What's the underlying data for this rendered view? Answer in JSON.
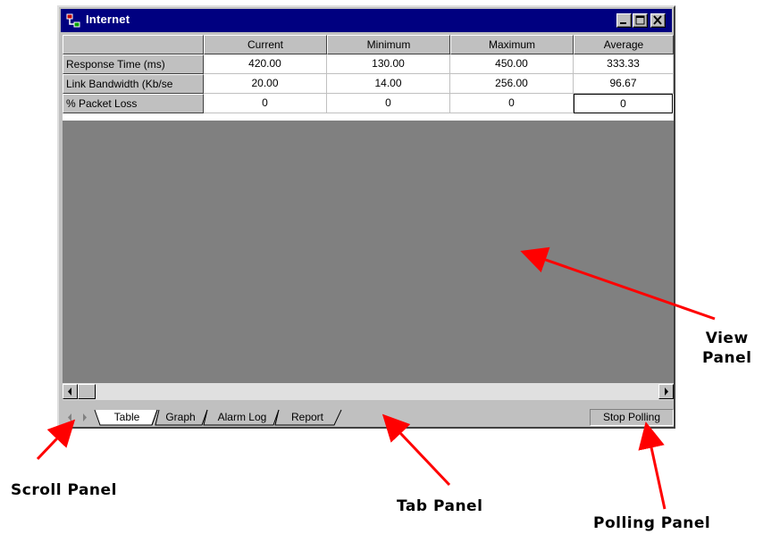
{
  "window": {
    "title": "Internet",
    "controls": [
      "minimize",
      "maximize",
      "close"
    ]
  },
  "table": {
    "columns": [
      "Current",
      "Minimum",
      "Maximum",
      "Average"
    ],
    "rows": [
      {
        "label": "Response Time (ms)",
        "values": [
          "420.00",
          "130.00",
          "450.00",
          "333.33"
        ]
      },
      {
        "label": "Link Bandwidth (Kb/se",
        "values": [
          "20.00",
          "14.00",
          "256.00",
          "96.67"
        ]
      },
      {
        "label": "% Packet Loss",
        "values": [
          "0",
          "0",
          "0",
          "0"
        ]
      }
    ]
  },
  "tabs": [
    {
      "label": "Table",
      "active": true
    },
    {
      "label": "Graph",
      "active": false
    },
    {
      "label": "Alarm Log",
      "active": false
    },
    {
      "label": "Report",
      "active": false
    }
  ],
  "polling": {
    "label": "Stop Polling"
  },
  "annotations": {
    "view_panel": "View\nPanel",
    "scroll_panel": "Scroll Panel",
    "tab_panel": "Tab Panel",
    "polling_panel": "Polling Panel"
  },
  "colors": {
    "titlebar": "#000080",
    "face": "#c0c0c0",
    "view_bg": "#808080",
    "arrow": "#ff0000"
  }
}
